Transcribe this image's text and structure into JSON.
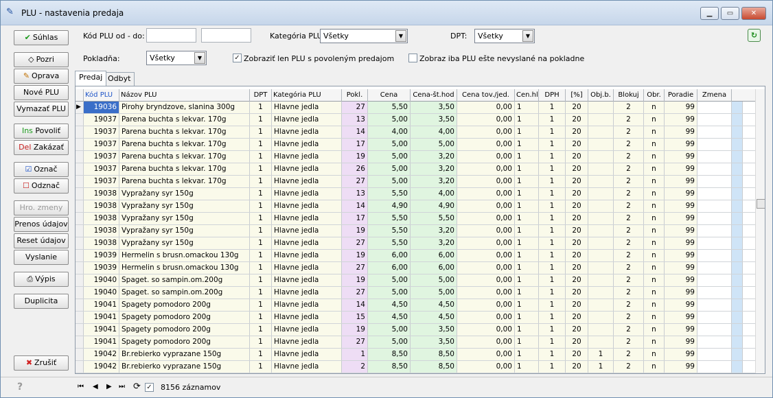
{
  "window": {
    "title": "PLU - nastavenia predaja",
    "minimize": "▁",
    "maximize": "▭",
    "close": "✕"
  },
  "left_buttons": {
    "suhlas": "Súhlas",
    "pozri": "Pozri",
    "oprava": "Oprava",
    "nove_plu": "Nové PLU",
    "vymazat_plu": "Vymazať PLU",
    "povolit_prefix": "Ins",
    "povolit": "Povoliť",
    "zakazat_prefix": "Del",
    "zakazat": "Zakázať",
    "oznac": "Označ",
    "odznac": "Odznač",
    "hro_zmeny": "Hro. zmeny",
    "prenos": "Prenos údajov",
    "reset": "Reset údajov",
    "vyslanie": "Vyslanie",
    "vypis": "Výpis",
    "duplicita": "Duplicita",
    "zrusit": "Zrušiť"
  },
  "filters": {
    "kod_label": "Kód PLU od - do:",
    "kod_from": "",
    "kod_to": "",
    "kategoria_label": "Kategória PLU:",
    "kategoria_value": "Všetky",
    "dpt_label": "DPT:",
    "dpt_value": "Všetky",
    "pokladna_label": "Pokladňa:",
    "pokladna_value": "Všetky",
    "chk1_label": "Zobraziť len PLU s povoleným predajom",
    "chk1": "✓",
    "chk2_label": "Zobraz iba PLU ešte nevyslané na pokladne",
    "chk2": ""
  },
  "tabs": [
    "Predaj",
    "Odbyt"
  ],
  "grid": {
    "headers": [
      "Kód PLU",
      "Názov PLU",
      "DPT",
      "Kategória PLU",
      "Pokl.",
      "Cena",
      "Cena-št.hod",
      "Cena tov./jed.",
      "Cen.hl.",
      "DPH",
      "[%]",
      "Obj.b.",
      "Blokuj",
      "Obr.",
      "Poradie",
      "Zmena"
    ],
    "rows": [
      [
        "19036",
        "Pirohy bryndzove, slanina 300g",
        "1",
        "Hlavne jedla",
        "27",
        "5,50",
        "3,50",
        "0,00",
        "1",
        "1",
        "20",
        "",
        "2",
        "n",
        "99",
        ""
      ],
      [
        "19037",
        "Parena buchta s lekvar. 170g",
        "1",
        "Hlavne jedla",
        "13",
        "5,00",
        "3,50",
        "0,00",
        "1",
        "1",
        "20",
        "",
        "2",
        "n",
        "99",
        ""
      ],
      [
        "19037",
        "Parena buchta s lekvar. 170g",
        "1",
        "Hlavne jedla",
        "14",
        "4,00",
        "4,00",
        "0,00",
        "1",
        "1",
        "20",
        "",
        "2",
        "n",
        "99",
        ""
      ],
      [
        "19037",
        "Parena buchta s lekvar. 170g",
        "1",
        "Hlavne jedla",
        "17",
        "5,00",
        "5,00",
        "0,00",
        "1",
        "1",
        "20",
        "",
        "2",
        "n",
        "99",
        ""
      ],
      [
        "19037",
        "Parena buchta s lekvar. 170g",
        "1",
        "Hlavne jedla",
        "19",
        "5,00",
        "3,20",
        "0,00",
        "1",
        "1",
        "20",
        "",
        "2",
        "n",
        "99",
        ""
      ],
      [
        "19037",
        "Parena buchta s lekvar. 170g",
        "1",
        "Hlavne jedla",
        "26",
        "5,00",
        "3,20",
        "0,00",
        "1",
        "1",
        "20",
        "",
        "2",
        "n",
        "99",
        ""
      ],
      [
        "19037",
        "Parena buchta s lekvar. 170g",
        "1",
        "Hlavne jedla",
        "27",
        "5,00",
        "3,20",
        "0,00",
        "1",
        "1",
        "20",
        "",
        "2",
        "n",
        "99",
        ""
      ],
      [
        "19038",
        "Vypražany syr 150g",
        "1",
        "Hlavne jedla",
        "13",
        "5,50",
        "4,00",
        "0,00",
        "1",
        "1",
        "20",
        "",
        "2",
        "n",
        "99",
        ""
      ],
      [
        "19038",
        "Vypražany syr 150g",
        "1",
        "Hlavne jedla",
        "14",
        "4,90",
        "4,90",
        "0,00",
        "1",
        "1",
        "20",
        "",
        "2",
        "n",
        "99",
        ""
      ],
      [
        "19038",
        "Vypražany syr 150g",
        "1",
        "Hlavne jedla",
        "17",
        "5,50",
        "5,50",
        "0,00",
        "1",
        "1",
        "20",
        "",
        "2",
        "n",
        "99",
        ""
      ],
      [
        "19038",
        "Vypražany syr 150g",
        "1",
        "Hlavne jedla",
        "19",
        "5,50",
        "3,20",
        "0,00",
        "1",
        "1",
        "20",
        "",
        "2",
        "n",
        "99",
        ""
      ],
      [
        "19038",
        "Vypražany syr 150g",
        "1",
        "Hlavne jedla",
        "27",
        "5,50",
        "3,20",
        "0,00",
        "1",
        "1",
        "20",
        "",
        "2",
        "n",
        "99",
        ""
      ],
      [
        "19039",
        "Hermelin s brusn.omackou 130g",
        "1",
        "Hlavne jedla",
        "19",
        "6,00",
        "6,00",
        "0,00",
        "1",
        "1",
        "20",
        "",
        "2",
        "n",
        "99",
        ""
      ],
      [
        "19039",
        "Hermelin s brusn.omackou 130g",
        "1",
        "Hlavne jedla",
        "27",
        "6,00",
        "6,00",
        "0,00",
        "1",
        "1",
        "20",
        "",
        "2",
        "n",
        "99",
        ""
      ],
      [
        "19040",
        "Spaget. so sampin.om.200g",
        "1",
        "Hlavne jedla",
        "19",
        "5,00",
        "5,00",
        "0,00",
        "1",
        "1",
        "20",
        "",
        "2",
        "n",
        "99",
        ""
      ],
      [
        "19040",
        "Spaget. so sampin.om.200g",
        "1",
        "Hlavne jedla",
        "27",
        "5,00",
        "5,00",
        "0,00",
        "1",
        "1",
        "20",
        "",
        "2",
        "n",
        "99",
        ""
      ],
      [
        "19041",
        "Spagety pomodoro 200g",
        "1",
        "Hlavne jedla",
        "14",
        "4,50",
        "4,50",
        "0,00",
        "1",
        "1",
        "20",
        "",
        "2",
        "n",
        "99",
        ""
      ],
      [
        "19041",
        "Spagety pomodoro 200g",
        "1",
        "Hlavne jedla",
        "15",
        "4,50",
        "4,50",
        "0,00",
        "1",
        "1",
        "20",
        "",
        "2",
        "n",
        "99",
        ""
      ],
      [
        "19041",
        "Spagety pomodoro 200g",
        "1",
        "Hlavne jedla",
        "19",
        "5,00",
        "3,50",
        "0,00",
        "1",
        "1",
        "20",
        "",
        "2",
        "n",
        "99",
        ""
      ],
      [
        "19041",
        "Spagety pomodoro 200g",
        "1",
        "Hlavne jedla",
        "27",
        "5,00",
        "3,50",
        "0,00",
        "1",
        "1",
        "20",
        "",
        "2",
        "n",
        "99",
        ""
      ],
      [
        "19042",
        "Br.rebierko vyprazane 150g",
        "1",
        "Hlavne jedla",
        "1",
        "8,50",
        "8,50",
        "0,00",
        "1",
        "1",
        "20",
        "1",
        "2",
        "n",
        "99",
        ""
      ],
      [
        "19042",
        "Br.rebierko vyprazane 150g",
        "1",
        "Hlavne jedla",
        "2",
        "8,50",
        "8,50",
        "0,00",
        "1",
        "1",
        "20",
        "1",
        "2",
        "n",
        "99",
        ""
      ]
    ]
  },
  "status": {
    "help": "?",
    "first": "⏮",
    "prev": "◀",
    "next": "▶",
    "last": "⏭",
    "refresh": "⟳",
    "chk": "✓",
    "records": "8156 záznamov"
  },
  "colors": {
    "row_bg": "#fafaea",
    "pokl_bg": "#eeddf5",
    "cena_bg": "#e0f5e0",
    "zmena_col": "#cfe4f7",
    "accent": "#1f55c8"
  }
}
